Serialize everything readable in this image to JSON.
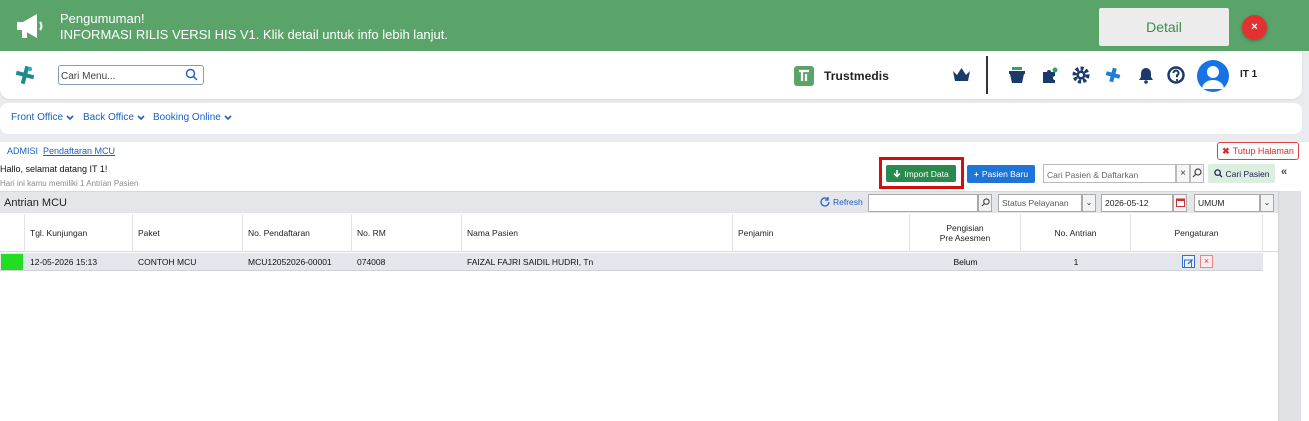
{
  "announcement": {
    "title": "Pengumuman!",
    "message": "INFORMASI RILIS VERSI HIS V1. Klik detail untuk info lebih lanjut.",
    "detail_label": "Detail",
    "close_label": "×",
    "icon": "megaphone-icon",
    "color": "#5aa46a"
  },
  "topnav": {
    "search_placeholder": "Cari Menu...",
    "brand": "Trustmedis",
    "user": "IT 1",
    "icons": [
      "crown-icon",
      "basket-icon",
      "puzzle-icon",
      "gear-icon",
      "plus-icon",
      "bell-icon",
      "help-icon",
      "avatar"
    ]
  },
  "menubar": {
    "items": [
      {
        "label": "Front Office"
      },
      {
        "label": "Back Office"
      },
      {
        "label": "Booking Online"
      }
    ]
  },
  "breadcrumb": {
    "items": [
      "ADMISI",
      "Pendaftaran MCU"
    ]
  },
  "page": {
    "close_label": "Tutup Halaman",
    "greeting": "Hallo, selamat datang IT 1!",
    "subgreeting": "Hari ini kamu memiliki 1 Antrian Pasien",
    "import_label": "Import Data",
    "new_patient_label": "Pasien Baru",
    "search_patient_placeholder": "Cari Pasien & Daftarkan",
    "search_patient_button": "Cari Pasien",
    "collapse": "«"
  },
  "panel": {
    "title": "Antrian MCU",
    "refresh_label": "Refresh",
    "status_placeholder": "Status Pelayanan",
    "date_value": "2026-05-12",
    "penjamin_value": "UMUM"
  },
  "table": {
    "columns": [
      "Tgl. Kunjungan",
      "Paket",
      "No. Pendaftaran",
      "No. RM",
      "Nama Pasien",
      "Penjamin",
      "Pengisian",
      "Pre Asesmen",
      "No. Antrian",
      "Pengaturan"
    ],
    "rows": [
      {
        "tgl": "12-05-2026 15:13",
        "paket": "CONTOH MCU",
        "no_pendaftaran": "MCU12052026-00001",
        "no_rm": "074008",
        "nama": "FAIZAL FAJRI SAIDIL HUDRI, Tn",
        "penjamin": "",
        "pengisian": "Belum",
        "antrian": "1",
        "status_color": "#22dd22"
      }
    ]
  }
}
